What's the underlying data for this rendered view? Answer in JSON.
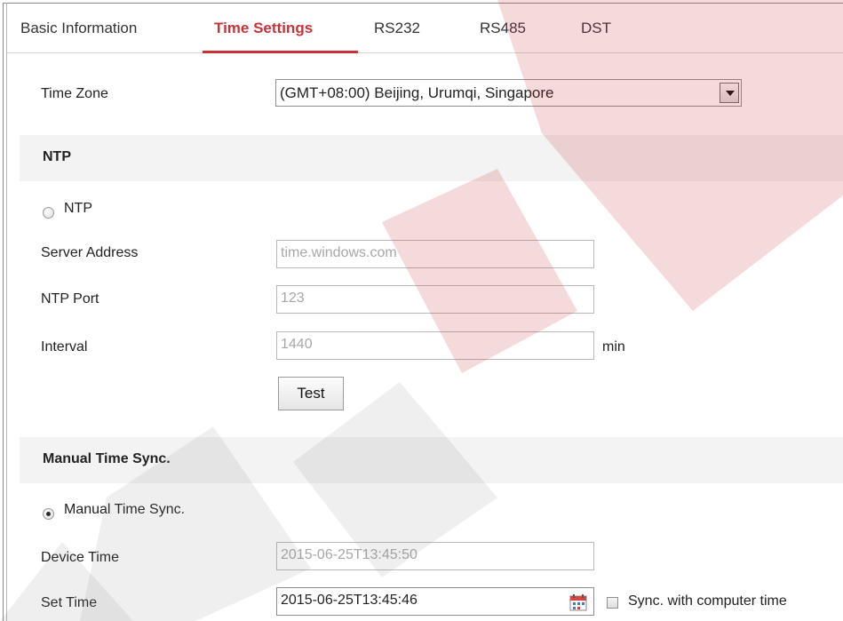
{
  "tabs": [
    {
      "label": "Basic Information",
      "active": false
    },
    {
      "label": "Time Settings",
      "active": true
    },
    {
      "label": "RS232",
      "active": false
    },
    {
      "label": "RS485",
      "active": false
    },
    {
      "label": "DST",
      "active": false
    }
  ],
  "time_zone": {
    "label": "Time Zone",
    "value": "(GMT+08:00) Beijing, Urumqi, Singapore"
  },
  "ntp": {
    "section_title": "NTP",
    "radio_label": "NTP",
    "selected": false,
    "server_address_label": "Server Address",
    "server_address_value": "time.windows.com",
    "port_label": "NTP Port",
    "port_value": "123",
    "interval_label": "Interval",
    "interval_value": "1440",
    "interval_unit": "min",
    "test_button": "Test"
  },
  "manual": {
    "section_title": "Manual Time Sync.",
    "radio_label": "Manual Time Sync.",
    "selected": true,
    "device_time_label": "Device Time",
    "device_time_value": "2015-06-25T13:45:50",
    "set_time_label": "Set Time",
    "set_time_value": "2015-06-25T13:45:46",
    "sync_checkbox_label": "Sync. with computer time",
    "sync_checked": false
  },
  "colors": {
    "accent": "#c8333a",
    "section_background": "#f3f3f3",
    "disabled_text": "#a7a7a7"
  },
  "icons": [
    "chevron-down-icon",
    "calendar-icon"
  ]
}
